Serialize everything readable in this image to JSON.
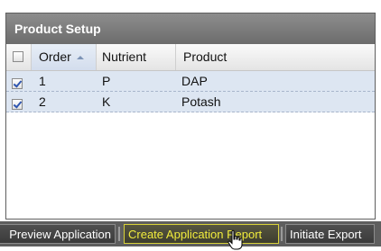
{
  "panel": {
    "title": "Product Setup"
  },
  "grid": {
    "columns": {
      "order": "Order",
      "nutrient": "Nutrient",
      "product": "Product"
    },
    "sort_column": "Order",
    "sort_direction": "ascending",
    "rows": [
      {
        "checked": true,
        "order": "1",
        "nutrient": "P",
        "product": "DAP"
      },
      {
        "checked": true,
        "order": "2",
        "nutrient": "K",
        "product": "Potash"
      }
    ]
  },
  "toolbar": {
    "preview_label": "Preview Application",
    "create_label": "Create Application Report",
    "export_label": "Initiate Export"
  },
  "icons": {
    "cursor": "hand-pointer-icon",
    "sort": "sort-ascending-icon",
    "checkbox": "checkbox-icon"
  },
  "colors": {
    "header_bg": "#7a7a7a",
    "row_bg": "#dde6f2",
    "toolbar_bg": "#5e5e5e",
    "highlight": "#f1ec3c"
  }
}
